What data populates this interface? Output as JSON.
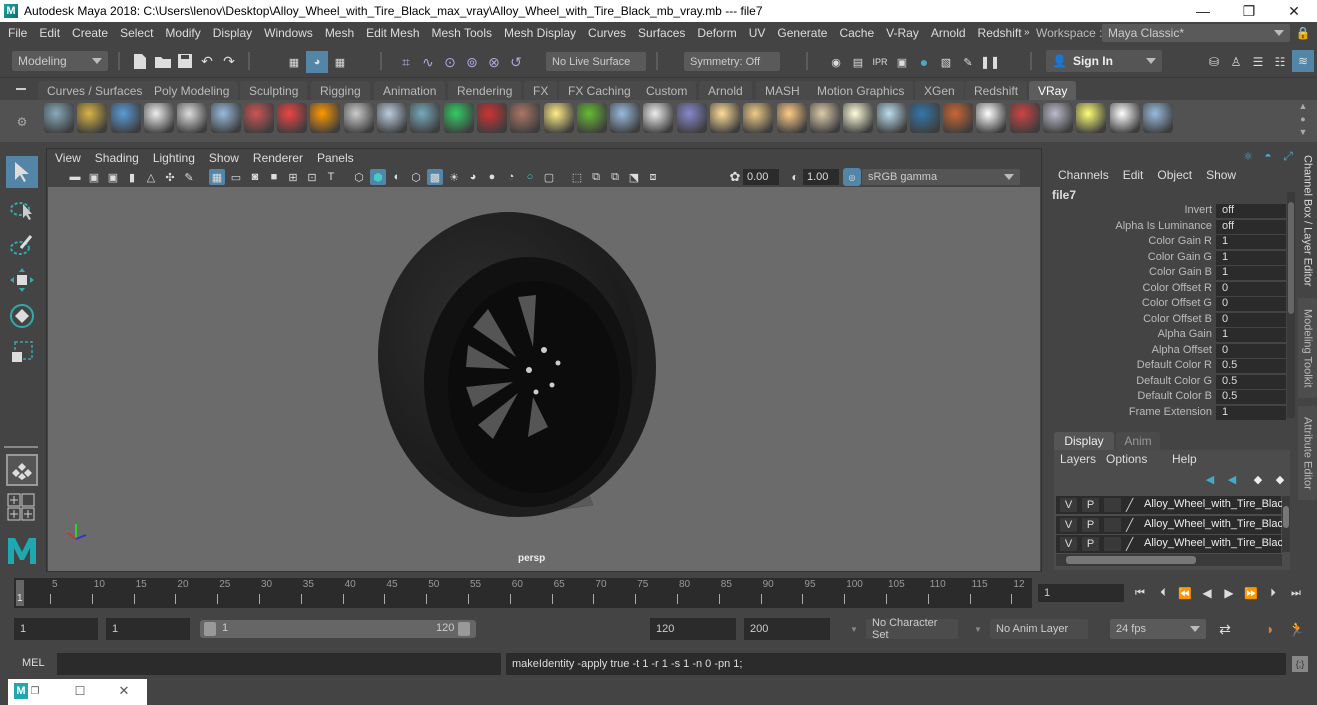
{
  "window": {
    "title": "Autodesk Maya 2018: C:\\Users\\lenov\\Desktop\\Alloy_Wheel_with_Tire_Black_max_vray\\Alloy_Wheel_with_Tire_Black_mb_vray.mb  ---  file7",
    "minimize_glyph": "—",
    "restore_glyph": "❐",
    "close_glyph": "✕"
  },
  "menubar": {
    "items": [
      "File",
      "Edit",
      "Create",
      "Select",
      "Modify",
      "Display",
      "Windows",
      "Mesh",
      "Edit Mesh",
      "Mesh Tools",
      "Mesh Display",
      "Curves",
      "Surfaces",
      "Deform",
      "UV",
      "Generate",
      "Cache",
      "V-Ray",
      "Arnold",
      "Redshift"
    ],
    "workspace_label": "Workspace :",
    "workspace_value": "Maya Classic*"
  },
  "statusline": {
    "mode": "Modeling",
    "live_surface": "No Live Surface",
    "symmetry": "Symmetry: Off",
    "sign_in": "Sign In"
  },
  "shelf": {
    "tabs": [
      "Curves / Surfaces",
      "Poly Modeling",
      "Sculpting",
      "Rigging",
      "Animation",
      "Rendering",
      "FX",
      "FX Caching",
      "Custom",
      "Arnold",
      "MASH",
      "Motion Graphics",
      "XGen",
      "Redshift",
      "VRay"
    ],
    "active_tab": "VRay",
    "icons": [
      "vray-export-icon",
      "vray-import-icon",
      "vray-scene-icon",
      "vray-logo-icon",
      "vray-log-icon",
      "vray-mtl-icon",
      "vray-camera-icon",
      "vray-material-icon",
      "vray-fire-icon",
      "vray-proxy-icon",
      "vray-cube-icon",
      "vray-plane-icon",
      "vray-light-mesh-icon",
      "vray-fur-icon",
      "vray-texture-icon",
      "vray-sphere-light-icon",
      "vray-grass-icon",
      "vray-clipper-icon",
      "vray-curve-icon",
      "vray-dome-icon",
      "vray-half-dome-icon",
      "vray-spot-icon",
      "vray-omni-icon",
      "vray-ies-icon",
      "vray-sun-icon",
      "vray-rect-light-icon",
      "vray-sphere-icon",
      "vray-bump-icon",
      "vray-checker-icon",
      "vray-frame-buffer-icon",
      "vray-render-settings-icon",
      "vray-light-lister-icon",
      "vray-cloud-icon",
      "help-icon"
    ]
  },
  "viewport": {
    "menu": [
      "View",
      "Shading",
      "Lighting",
      "Show",
      "Renderer",
      "Panels"
    ],
    "exposure": "0.00",
    "gamma": "1.00",
    "color_space": "sRGB gamma",
    "camera_label": "persp"
  },
  "channelbox": {
    "menu": [
      "Channels",
      "Edit",
      "Object",
      "Show"
    ],
    "node": "file7",
    "attributes": [
      {
        "label": "Invert",
        "value": "off"
      },
      {
        "label": "Alpha Is Luminance",
        "value": "off"
      },
      {
        "label": "Color Gain R",
        "value": "1"
      },
      {
        "label": "Color Gain G",
        "value": "1"
      },
      {
        "label": "Color Gain B",
        "value": "1"
      },
      {
        "label": "Color Offset R",
        "value": "0"
      },
      {
        "label": "Color Offset G",
        "value": "0"
      },
      {
        "label": "Color Offset B",
        "value": "0"
      },
      {
        "label": "Alpha Gain",
        "value": "1"
      },
      {
        "label": "Alpha Offset",
        "value": "0"
      },
      {
        "label": "Default Color R",
        "value": "0.5"
      },
      {
        "label": "Default Color G",
        "value": "0.5"
      },
      {
        "label": "Default Color B",
        "value": "0.5"
      },
      {
        "label": "Frame Extension",
        "value": "1"
      }
    ]
  },
  "layer_editor": {
    "tabs": [
      "Display",
      "Anim"
    ],
    "active_tab": "Display",
    "menu": [
      "Layers",
      "Options",
      "Help"
    ],
    "layers": [
      {
        "v": "V",
        "p": "P",
        "name": "Alloy_Wheel_with_Tire_Black"
      },
      {
        "v": "V",
        "p": "P",
        "name": "Alloy_Wheel_with_Tire_Black"
      },
      {
        "v": "V",
        "p": "P",
        "name": "Alloy_Wheel_with_Tire_Black"
      }
    ]
  },
  "side_tabs": [
    "Channel Box / Layer Editor",
    "Modeling Toolkit",
    "Attribute Editor"
  ],
  "timeslider": {
    "ticks": [
      "5",
      "10",
      "15",
      "20",
      "25",
      "30",
      "35",
      "40",
      "45",
      "50",
      "55",
      "60",
      "65",
      "70",
      "75",
      "80",
      "85",
      "90",
      "95",
      "100",
      "105",
      "110",
      "115",
      "12"
    ],
    "current_marker": "1",
    "current_frame": "1"
  },
  "range": {
    "start": "1",
    "playback_start": "1",
    "slider_start": "1",
    "slider_end": "120",
    "playback_end": "120",
    "end": "200",
    "character_set": "No Character Set",
    "anim_layer": "No Anim Layer",
    "fps": "24 fps"
  },
  "command": {
    "lang": "MEL",
    "input": "",
    "result": "makeIdentity -apply true -t 1 -r 1 -s 1 -n 0 -pn 1;"
  },
  "colors": {
    "accent": "#5285a6",
    "playhead": "#e07a2b",
    "viewport_bg": "#6b6b6b"
  }
}
